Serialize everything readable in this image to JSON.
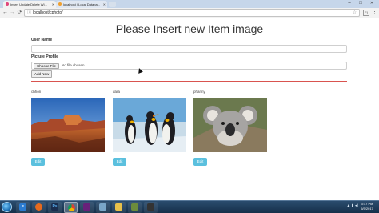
{
  "browser": {
    "tabs": [
      {
        "label": "Insert Update Delete Wi...",
        "active": true,
        "favicon_color": "#e0457b"
      },
      {
        "label": "localhost / Local Databa...",
        "active": false,
        "favicon_color": "#f0a030"
      }
    ],
    "address_bar": {
      "url": "localhost/cphoto/"
    },
    "window_controls": {
      "minimize": "–",
      "maximize": "□",
      "close": "✕"
    },
    "icons": {
      "back": "back-arrow-icon",
      "forward": "forward-arrow-icon",
      "reload": "reload-icon",
      "bookmark": "star-icon",
      "menu": "menu-icon"
    },
    "extension_label": "FI"
  },
  "page": {
    "heading": "Please Insert new Item image",
    "form": {
      "user_name_label": "User Name",
      "user_name_value": "",
      "picture_label": "Picture Profile",
      "choose_file_label": "Choose File",
      "file_status": "No file chosen",
      "add_button_label": "Add New"
    },
    "separator_color": "#d9534f",
    "items": [
      {
        "name": "chhon",
        "image": "desert-canyon",
        "edit_label": "Edit"
      },
      {
        "name": "dara",
        "image": "penguins",
        "edit_label": "Edit"
      },
      {
        "name": "phanny",
        "image": "koala",
        "edit_label": "Edit"
      }
    ]
  },
  "taskbar": {
    "apps": [
      "ie",
      "firefox",
      "photoshop",
      "chrome",
      "visual-studio",
      "window",
      "explorer",
      "notepad",
      "media"
    ],
    "clock_time": "3:17 PM",
    "clock_date": "5/5/2017"
  },
  "colors": {
    "accent_button": "#5bc0de",
    "taskbar": "#1f3d5c"
  }
}
